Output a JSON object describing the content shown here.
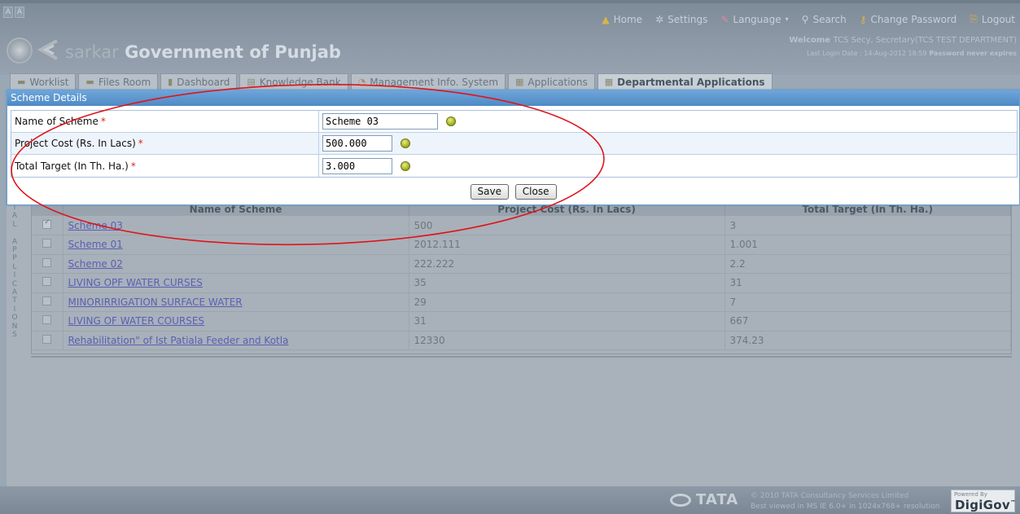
{
  "header": {
    "font_buttons": [
      "A",
      "A"
    ],
    "nav": [
      {
        "icon": "home-icon",
        "glyph": "▲",
        "label": "Home"
      },
      {
        "icon": "gear-icon",
        "glyph": "✲",
        "label": "Settings"
      },
      {
        "icon": "language-icon",
        "glyph": "✎",
        "label": "Language"
      },
      {
        "icon": "search-icon",
        "glyph": "⚲",
        "label": "Search"
      },
      {
        "icon": "key-icon",
        "glyph": "⚷",
        "label": "Change Password"
      },
      {
        "icon": "logout-icon",
        "glyph": "⎘",
        "label": "Logout"
      }
    ],
    "welcome_label": "Welcome",
    "welcome_text": "TCS Secy, Secretary(TCS TEST DEPARTMENT)",
    "last_login": "Last Login Date : 14-Aug-2012 18:59",
    "password_note": "Password never expires",
    "brand_sarkar": "sarkar",
    "brand_title": "Government of Punjab"
  },
  "tabs": [
    {
      "icon": "folder-icon",
      "glyph": "▬",
      "label": "Worklist"
    },
    {
      "icon": "files-icon",
      "glyph": "▬",
      "label": "Files Room"
    },
    {
      "icon": "dashboard-icon",
      "glyph": "▮",
      "label": "Dashboard"
    },
    {
      "icon": "book-icon",
      "glyph": "▤",
      "label": "Knowledge Bank"
    },
    {
      "icon": "chart-icon",
      "glyph": "◔",
      "label": "Management Info. System"
    },
    {
      "icon": "applications-icon",
      "glyph": "▦",
      "label": "Applications"
    },
    {
      "icon": "departmental-icon",
      "glyph": "▦",
      "label": "Departmental Applications"
    }
  ],
  "sidebar_vertical": [
    "I",
    "A",
    "L",
    "",
    "A",
    "P",
    "P",
    "L",
    "I",
    "C",
    "A",
    "T",
    "I",
    "O",
    "N",
    "S"
  ],
  "grid": {
    "columns": [
      "Name of Scheme",
      "Project Cost (Rs. In Lacs)",
      "Total Target (In Th. Ha.)"
    ],
    "rows": [
      {
        "checked": true,
        "name": "Scheme 03",
        "cost": "500",
        "target": "3"
      },
      {
        "checked": false,
        "name": "Scheme 01",
        "cost": "2012.111",
        "target": "1.001"
      },
      {
        "checked": false,
        "name": "Scheme 02",
        "cost": "222.222",
        "target": "2.2"
      },
      {
        "checked": false,
        "name": "LIVING OPF WATER CURSES",
        "cost": "35",
        "target": "31"
      },
      {
        "checked": false,
        "name": "MINORIRRIGATION SURFACE WATER",
        "cost": "29",
        "target": "7"
      },
      {
        "checked": false,
        "name": "LIVING OF WATER COURSES",
        "cost": "31",
        "target": "667"
      },
      {
        "checked": false,
        "name": "Rehabilitation\" of Ist Patiala Feeder and Kotla",
        "cost": "12330",
        "target": "374.23"
      }
    ]
  },
  "modal": {
    "title": "Scheme Details",
    "fields": [
      {
        "label": "Name of Scheme",
        "required": "*",
        "value": "Scheme 03"
      },
      {
        "label": "Project Cost (Rs. In Lacs)",
        "required": "*",
        "value": "500.000"
      },
      {
        "label": "Total Target (In Th. Ha.)",
        "required": "*",
        "value": "3.000"
      }
    ],
    "save_label": "Save",
    "close_label": "Close"
  },
  "footer": {
    "tata": "TATA",
    "copyright": "© 2010 TATA Consultancy Services Limited",
    "best_viewed": "Best viewed in MS IE 6.0+ in 1024x768+ resolution",
    "powered_by": "Powered By",
    "digigov": "DigiGov",
    "trademark": "™"
  },
  "colors": {
    "modal_title_bar": "#4e8ac6",
    "required_star": "#e2221c",
    "annotation": "#e0141a",
    "link": "#5a5fb3"
  }
}
